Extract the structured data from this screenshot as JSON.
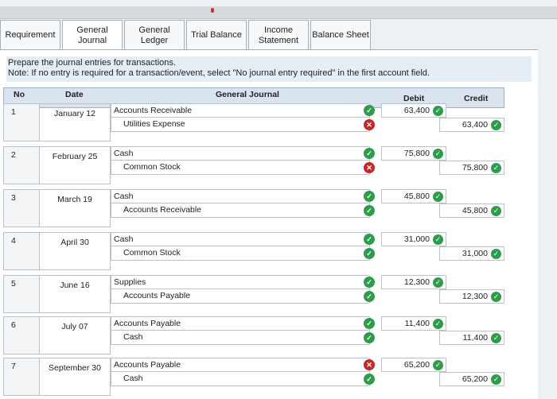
{
  "tabs": [
    {
      "label": "Requirement",
      "active": false
    },
    {
      "label": "General\nJournal",
      "active": true
    },
    {
      "label": "General\nLedger",
      "active": false
    },
    {
      "label": "Trial Balance",
      "active": false
    },
    {
      "label": "Income\nStatement",
      "active": false
    },
    {
      "label": "Balance Sheet",
      "active": false
    }
  ],
  "instructions": {
    "line1": "Prepare the journal entries for transactions.",
    "line2": "Note: If no entry is required for a transaction/event, select \"No journal entry required\" in the first account field."
  },
  "table": {
    "headers": {
      "no": "No",
      "date": "Date",
      "journal": "General Journal",
      "debit": "Debit",
      "credit": "Credit"
    },
    "entries": [
      {
        "no": "1",
        "date": "January 12",
        "account1": "Accounts Receivable",
        "account2": "Utilities Expense",
        "status1": "correct",
        "status2": "incorrect",
        "debit": "63,400",
        "credit": "63,400"
      },
      {
        "no": "2",
        "date": "February 25",
        "account1": "Cash",
        "account2": "Common Stock",
        "status1": "correct",
        "status2": "incorrect",
        "debit": "75,800",
        "credit": "75,800"
      },
      {
        "no": "3",
        "date": "March 19",
        "account1": "Cash",
        "account2": "Accounts Receivable",
        "status1": "correct",
        "status2": "correct",
        "debit": "45,800",
        "credit": "45,800"
      },
      {
        "no": "4",
        "date": "April 30",
        "account1": "Cash",
        "account2": "Common Stock",
        "status1": "correct",
        "status2": "correct",
        "debit": "31,000",
        "credit": "31,000"
      },
      {
        "no": "5",
        "date": "June 16",
        "account1": "Supplies",
        "account2": "Accounts Payable",
        "status1": "correct",
        "status2": "correct",
        "debit": "12,300",
        "credit": "12,300"
      },
      {
        "no": "6",
        "date": "July 07",
        "account1": "Accounts Payable",
        "account2": "Cash",
        "status1": "correct",
        "status2": "correct",
        "debit": "11,400",
        "credit": "11,400"
      },
      {
        "no": "7",
        "date": "September 30",
        "account1": "Accounts Payable",
        "account2": "Cash",
        "status1": "incorrect",
        "status2": "correct",
        "debit": "65,200",
        "credit": "65,200"
      }
    ]
  },
  "icons": {
    "correct": "check-circle-icon",
    "incorrect": "x-circle-icon"
  },
  "colors": {
    "correct": "#2e9c4b",
    "incorrect": "#c62828",
    "header_bg": "#d9e4ef"
  }
}
